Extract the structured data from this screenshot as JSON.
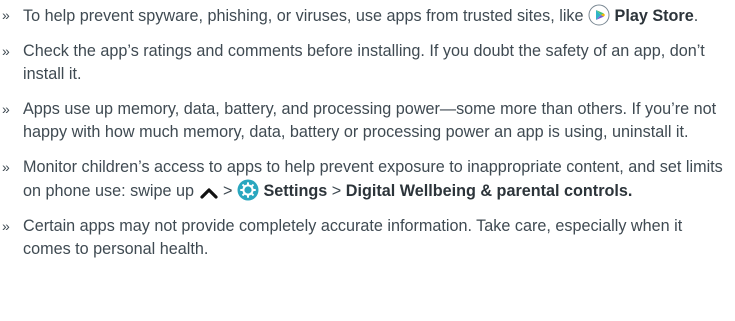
{
  "bullet_glyph": "»",
  "items": [
    {
      "parts": [
        {
          "type": "text",
          "text": "To help prevent spyware, phishing, or viruses, use apps from trusted sites, like "
        },
        {
          "type": "icon",
          "icon": "play-store-icon"
        },
        {
          "type": "text",
          "text": " "
        },
        {
          "type": "bold",
          "text": "Play Store"
        },
        {
          "type": "text",
          "text": "."
        }
      ]
    },
    {
      "parts": [
        {
          "type": "text",
          "text": "Check the app’s ratings and comments before installing. If you doubt the safety of an app, don’t install it."
        }
      ]
    },
    {
      "parts": [
        {
          "type": "text",
          "text": "Apps use up memory, data, battery, and processing power—some more than others. If you’re not happy with how much memory, data, battery or processing power an app is using, uninstall it."
        }
      ]
    },
    {
      "parts": [
        {
          "type": "text",
          "text": "Monitor children’s access to apps to help prevent exposure to inappropriate content, and set limits on phone use: swipe up "
        },
        {
          "type": "icon",
          "icon": "chevron-up-icon"
        },
        {
          "type": "text",
          "text": " > "
        },
        {
          "type": "icon",
          "icon": "settings-gear-icon"
        },
        {
          "type": "text",
          "text": " "
        },
        {
          "type": "bold",
          "text": "Settings"
        },
        {
          "type": "text",
          "text": " > "
        },
        {
          "type": "bold",
          "text": "Digital Wellbeing & parental controls."
        }
      ]
    },
    {
      "parts": [
        {
          "type": "text",
          "text": "Certain apps may not provide completely accurate information. Take care, especially when it comes to personal health."
        }
      ]
    }
  ],
  "colors": {
    "text": "#3f4a52",
    "play_teal": "#2fb5c9",
    "play_yellow": "#f5b800",
    "play_purple": "#7a5cd6",
    "settings_teal": "#2aa7bf"
  }
}
